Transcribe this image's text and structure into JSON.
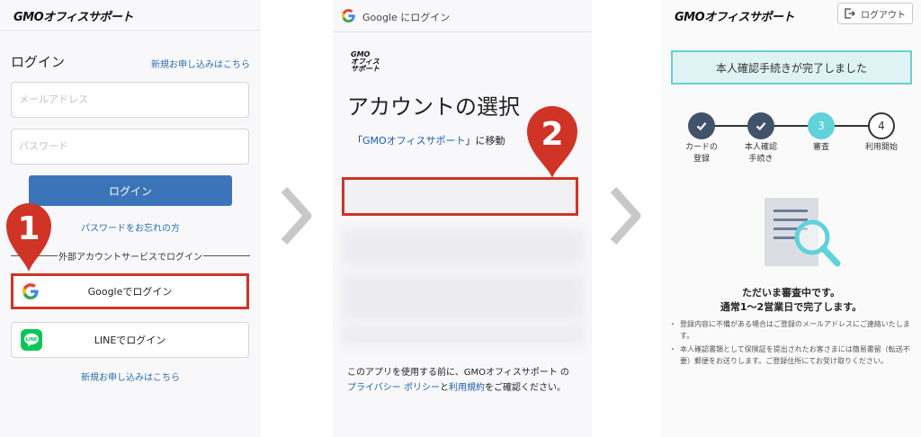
{
  "screen1": {
    "brand": "GMOオフィスサポート",
    "title": "ログイン",
    "signup_top": "新規お申し込みはこちら",
    "email_placeholder": "メールアドレス",
    "password_placeholder": "パスワード",
    "login_button": "ログイン",
    "forgot_password": "パスワードをお忘れの方",
    "external_divider": "外部アカウントサービスでログイン",
    "google_button": "Googleでログイン",
    "line_button": "LINEでログイン",
    "signup_bottom": "新規お申し込みはこちら",
    "step_marker": "1"
  },
  "screen2": {
    "header": "Google にログイン",
    "app_logo": [
      "GMO",
      "オフィス",
      "サポート"
    ],
    "heading": "アカウントの選択",
    "continue_prefix": "「",
    "continue_app": "GMOオフィスサポート",
    "continue_suffix": "」に移動",
    "footer_1": "このアプリを使用する前に、GMOオフィスサポート の",
    "privacy_link": "プライバシー ポリシー",
    "footer_and": "と",
    "terms_link": "利用規約",
    "footer_2": "をご確認ください。",
    "step_marker": "2"
  },
  "screen3": {
    "brand": "GMOオフィスサポート",
    "logout": "ログアウト",
    "banner": "本人確認手続きが完了しました",
    "steps": [
      {
        "number": "",
        "label": "カードの\n登録",
        "status": "done"
      },
      {
        "number": "",
        "label": "本人確認\n手続き",
        "status": "done"
      },
      {
        "number": "3",
        "label": "審査",
        "status": "current"
      },
      {
        "number": "4",
        "label": "利用開始",
        "status": "todo"
      }
    ],
    "review_line1": "ただいま審査中です。",
    "review_line2": "通常1〜2営業日で完了します。",
    "notes": [
      "登録内容に不備がある場合はご登録のメールアドレスにご連絡いたします。",
      "本人確認書類として保険証を提出されたお客さまには簡易書留（転送不要）郵便をお送りします。ご登録住所にてお受け取りください。"
    ]
  },
  "colors": {
    "highlight_red": "#cf3426",
    "login_blue": "#3b74b8",
    "link_blue": "#2b6cb0",
    "teal": "#5fd2da",
    "step_done": "#40536a"
  },
  "icons": {
    "arrows": "chevron-right-icon",
    "google": "google-g-icon",
    "line": "line-app-icon",
    "logout": "logout-icon",
    "check": "check-icon",
    "review": "document-magnifier-icon"
  }
}
